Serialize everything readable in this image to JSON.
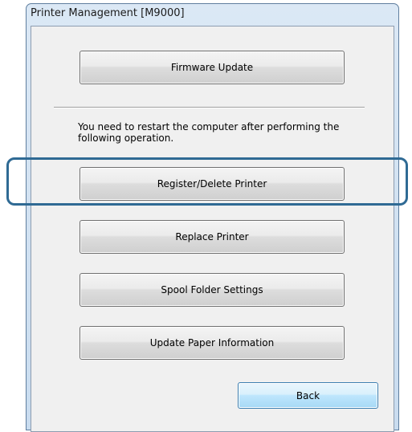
{
  "window": {
    "title": "Printer Management [M9000]"
  },
  "buttons": {
    "firmware_update": "Firmware Update",
    "register_delete": "Register/Delete Printer",
    "replace_printer": "Replace Printer",
    "spool_folder": "Spool Folder Settings",
    "update_paper": "Update Paper Information",
    "back": "Back"
  },
  "notice": {
    "text": "You need to restart the computer after performing the following operation."
  },
  "colors": {
    "highlight": "#2f6a94",
    "title_bar": "#c9dcef",
    "dialog_background": "#f0f0f0"
  }
}
